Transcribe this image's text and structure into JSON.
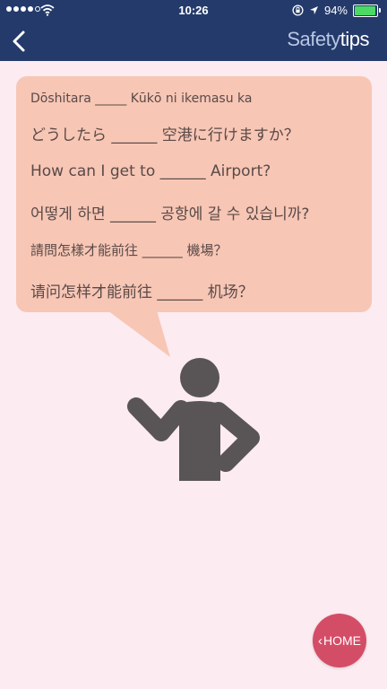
{
  "status_bar": {
    "time": "10:26",
    "battery_percent": "94%",
    "battery_level": 0.94,
    "signal_bars_filled": 4,
    "signal_bars_total": 5
  },
  "nav": {
    "back_icon": "chevron-left-icon",
    "title_light": "Safety",
    "title_bold": "tips"
  },
  "bubble": {
    "color": "#f7c6b5",
    "phrases": [
      "Dōshitara _____ Kūkō ni ikemasu ka",
      "どうしたら ______ 空港に行けますか？",
      "How can I get to ______ Airport?",
      "어떻게 하면 ______ 공항에 갈 수 있습니까?",
      "請問怎樣才能前往 ______ 機場？",
      "请问怎样才能前往 ______ 机场？"
    ]
  },
  "figure": {
    "icon": "person-asking-icon",
    "color": "#595557"
  },
  "home_button": {
    "label": "HOME",
    "color": "#d44d67"
  },
  "colors": {
    "header": "#243a6b",
    "background": "#fcebf1"
  }
}
